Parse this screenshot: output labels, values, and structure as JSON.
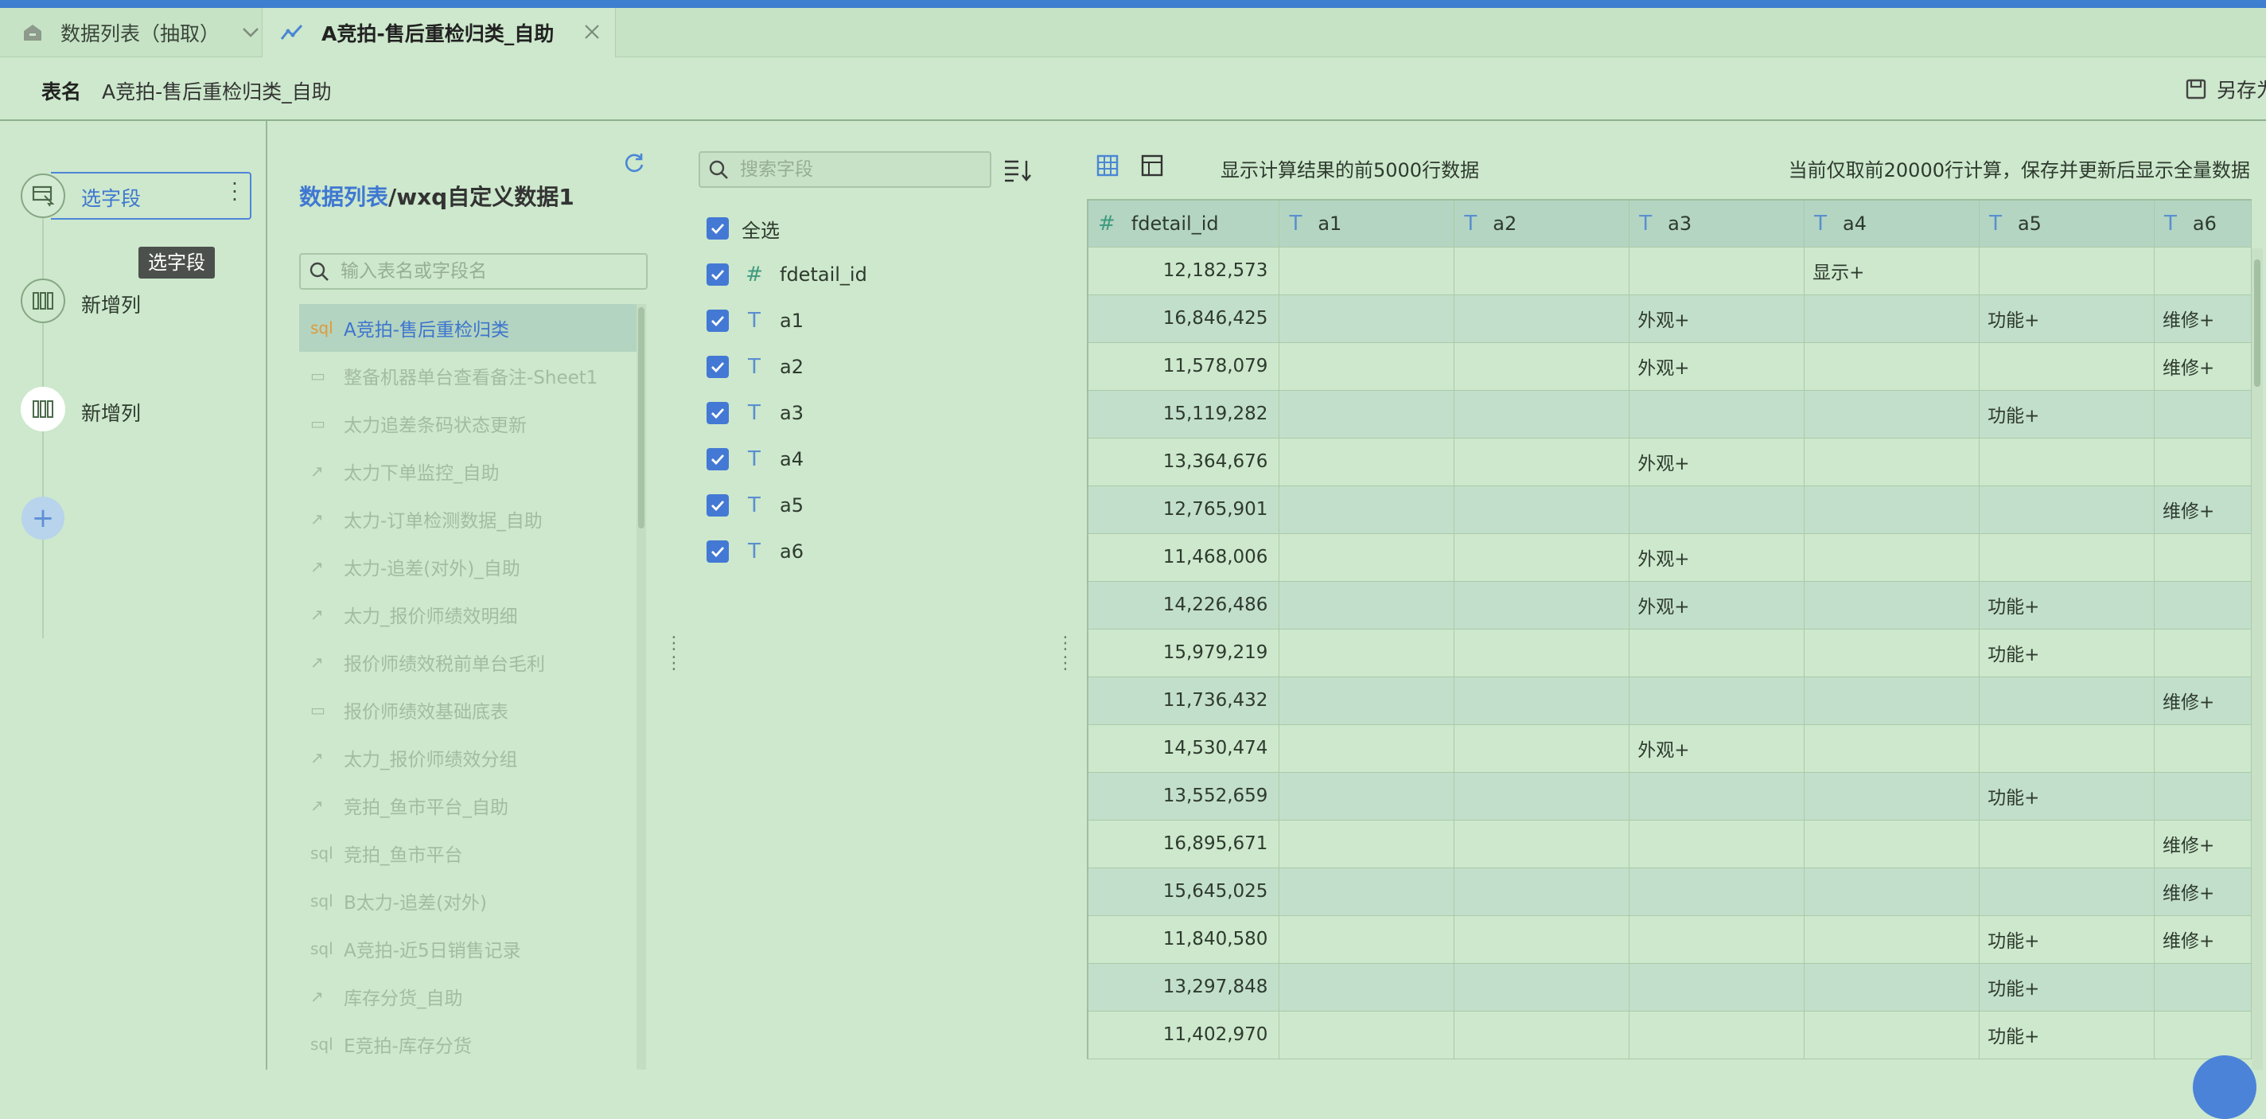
{
  "tabs": [
    {
      "label": "数据列表（抽取）",
      "icon": "home-icon"
    },
    {
      "label": "A竞拍-售后重检归类_自助",
      "icon": "line-chart-icon"
    }
  ],
  "header": {
    "table_name_key": "表名",
    "table_name_value": "A竞拍-售后重检归类_自助",
    "save_as_label": "另存为"
  },
  "flow": {
    "steps": [
      {
        "label": "选字段",
        "icon": "field-select-icon"
      },
      {
        "label": "新增列",
        "icon": "add-column-icon"
      },
      {
        "label": "新增列",
        "icon": "add-column-icon"
      }
    ],
    "tooltip": "选字段",
    "add_symbol": "+"
  },
  "table_panel": {
    "path_prefix": "数据列表",
    "path_rest": "/wxq自定义数据1",
    "search_placeholder": "输入表名或字段名",
    "items": [
      {
        "type": "sql",
        "label": "A竞拍-售后重检归类"
      },
      {
        "type": "db",
        "label": "整备机器单台查看备注-Sheet1"
      },
      {
        "type": "db",
        "label": "太力追差条码状态更新"
      },
      {
        "type": "analysis",
        "label": "太力下单监控_自助"
      },
      {
        "type": "analysis",
        "label": "太力-订单检测数据_自助"
      },
      {
        "type": "analysis",
        "label": "太力-追差(对外)_自助"
      },
      {
        "type": "analysis",
        "label": "太力_报价师绩效明细"
      },
      {
        "type": "analysis",
        "label": "报价师绩效税前单台毛利"
      },
      {
        "type": "db",
        "label": "报价师绩效基础底表"
      },
      {
        "type": "analysis",
        "label": "太力_报价师绩效分组"
      },
      {
        "type": "analysis",
        "label": "竞拍_鱼市平台_自助"
      },
      {
        "type": "sql",
        "label": "竞拍_鱼市平台"
      },
      {
        "type": "sql",
        "label": "B太力-追差(对外)"
      },
      {
        "type": "sql",
        "label": "A竞拍-近5日销售记录"
      },
      {
        "type": "analysis",
        "label": "库存分货_自助"
      },
      {
        "type": "sql",
        "label": "E竞拍-库存分货"
      }
    ]
  },
  "field_panel": {
    "search_placeholder": "搜索字段",
    "select_all": "全选",
    "fields": [
      {
        "type": "#",
        "name": "fdetail_id"
      },
      {
        "type": "T",
        "name": "a1"
      },
      {
        "type": "T",
        "name": "a2"
      },
      {
        "type": "T",
        "name": "a3"
      },
      {
        "type": "T",
        "name": "a4"
      },
      {
        "type": "T",
        "name": "a5"
      },
      {
        "type": "T",
        "name": "a6"
      }
    ]
  },
  "data_panel": {
    "info": "显示计算结果的前5000行数据",
    "note": "当前仅取前20000行计算，保存并更新后显示全量数据",
    "columns": [
      {
        "type": "#",
        "name": "fdetail_id"
      },
      {
        "type": "T",
        "name": "a1"
      },
      {
        "type": "T",
        "name": "a2"
      },
      {
        "type": "T",
        "name": "a3"
      },
      {
        "type": "T",
        "name": "a4"
      },
      {
        "type": "T",
        "name": "a5"
      },
      {
        "type": "T",
        "name": "a6"
      }
    ],
    "rows": [
      [
        "12,182,573",
        "",
        "",
        "",
        "显示+",
        "",
        ""
      ],
      [
        "16,846,425",
        "",
        "",
        "外观+",
        "",
        "功能+",
        "维修+"
      ],
      [
        "11,578,079",
        "",
        "",
        "外观+",
        "",
        "",
        "维修+"
      ],
      [
        "15,119,282",
        "",
        "",
        "",
        "",
        "功能+",
        ""
      ],
      [
        "13,364,676",
        "",
        "",
        "外观+",
        "",
        "",
        ""
      ],
      [
        "12,765,901",
        "",
        "",
        "",
        "",
        "",
        "维修+"
      ],
      [
        "11,468,006",
        "",
        "",
        "外观+",
        "",
        "",
        ""
      ],
      [
        "14,226,486",
        "",
        "",
        "外观+",
        "",
        "功能+",
        ""
      ],
      [
        "15,979,219",
        "",
        "",
        "",
        "",
        "功能+",
        ""
      ],
      [
        "11,736,432",
        "",
        "",
        "",
        "",
        "",
        "维修+"
      ],
      [
        "14,530,474",
        "",
        "",
        "外观+",
        "",
        "",
        ""
      ],
      [
        "13,552,659",
        "",
        "",
        "",
        "",
        "功能+",
        ""
      ],
      [
        "16,895,671",
        "",
        "",
        "",
        "",
        "",
        "维修+"
      ],
      [
        "15,645,025",
        "",
        "",
        "",
        "",
        "",
        "维修+"
      ],
      [
        "11,840,580",
        "",
        "",
        "",
        "",
        "功能+",
        "维修+"
      ],
      [
        "13,297,848",
        "",
        "",
        "",
        "",
        "功能+",
        ""
      ],
      [
        "11,402,970",
        "",
        "",
        "",
        "",
        "功能+",
        ""
      ]
    ]
  }
}
